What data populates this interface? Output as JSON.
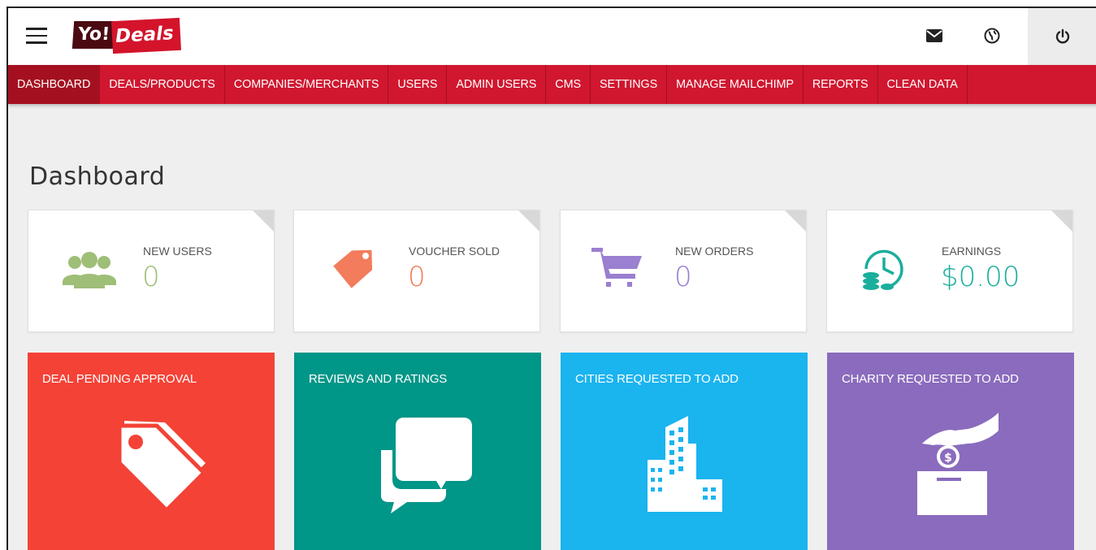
{
  "app": {
    "logo_yo": "Yo!",
    "logo_deals": "Deals"
  },
  "nav": [
    {
      "label": "DASHBOARD",
      "active": true
    },
    {
      "label": "DEALS/PRODUCTS"
    },
    {
      "label": "COMPANIES/MERCHANTS"
    },
    {
      "label": "USERS"
    },
    {
      "label": "ADMIN USERS"
    },
    {
      "label": "CMS"
    },
    {
      "label": "SETTINGS"
    },
    {
      "label": "MANAGE MAILCHIMP"
    },
    {
      "label": "REPORTS"
    },
    {
      "label": "CLEAN DATA"
    }
  ],
  "page": {
    "title": "Dashboard"
  },
  "stats": [
    {
      "label": "NEW USERS",
      "value": "0",
      "color": "#9fbe78",
      "icon": "users-icon"
    },
    {
      "label": "VOUCHER SOLD",
      "value": "0",
      "color": "#f27c5c",
      "icon": "tag-icon"
    },
    {
      "label": "NEW ORDERS",
      "value": "0",
      "color": "#9b7fd0",
      "icon": "cart-icon"
    },
    {
      "label": "EARNINGS",
      "value": "$0.00",
      "color": "#1aae9c",
      "icon": "clock-coins-icon"
    }
  ],
  "tiles": [
    {
      "label": "DEAL PENDING APPROVAL",
      "color": "#f44236",
      "icon": "tags-icon"
    },
    {
      "label": "REVIEWS AND RATINGS",
      "color": "#009688",
      "icon": "chat-bubbles-icon"
    },
    {
      "label": "CITIES REQUESTED TO ADD",
      "color": "#1ab4ef",
      "icon": "buildings-icon"
    },
    {
      "label": "CHARITY REQUESTED TO ADD",
      "color": "#8a6bbd",
      "icon": "donation-icon"
    }
  ]
}
